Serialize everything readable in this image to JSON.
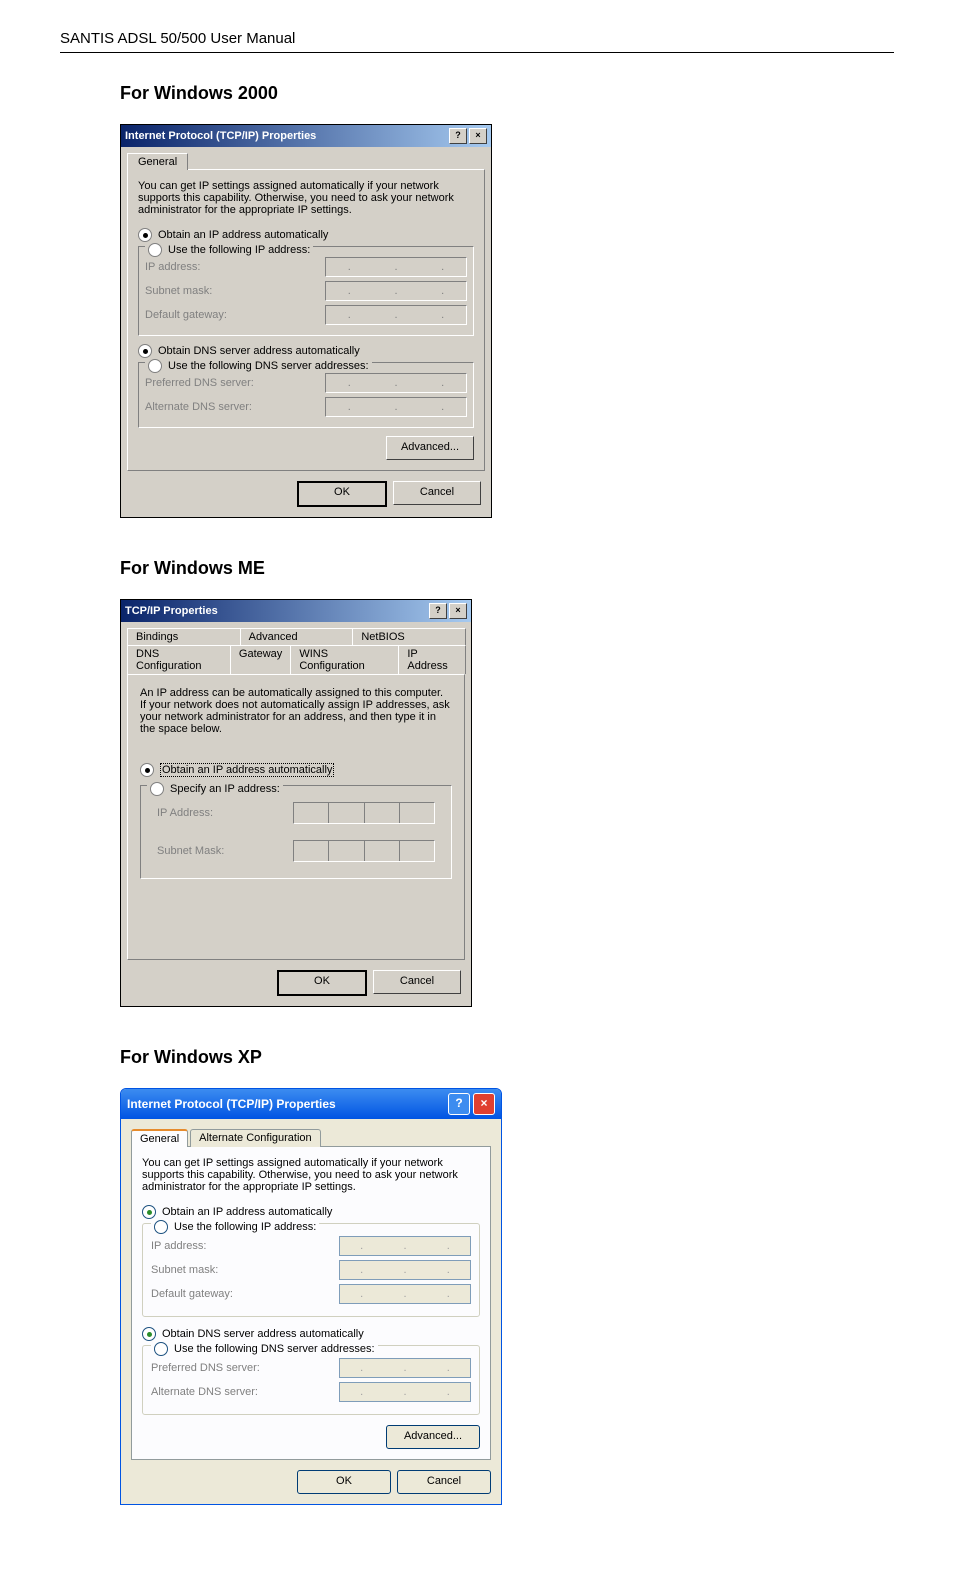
{
  "header": "SANTIS ADSL 50/500 User Manual",
  "sections": {
    "win2000": {
      "heading": "For Windows 2000",
      "dialog": {
        "title": "Internet Protocol (TCP/IP) Properties",
        "tab": "General",
        "description": "You can get IP settings assigned automatically if your network supports this capability. Otherwise, you need to ask your network administrator for the appropriate IP settings.",
        "radio_obtain_ip": "Obtain an IP address automatically",
        "radio_use_ip": "Use the following IP address:",
        "ip_address_label": "IP address:",
        "subnet_label": "Subnet mask:",
        "gateway_label": "Default gateway:",
        "radio_obtain_dns": "Obtain DNS server address automatically",
        "radio_use_dns": "Use the following DNS server addresses:",
        "pref_dns_label": "Preferred DNS server:",
        "alt_dns_label": "Alternate DNS server:",
        "advanced_btn": "Advanced...",
        "ok_btn": "OK",
        "cancel_btn": "Cancel"
      }
    },
    "winme": {
      "heading": "For Windows ME",
      "dialog": {
        "title": "TCP/IP Properties",
        "tabs": {
          "bindings": "Bindings",
          "advanced": "Advanced",
          "netbios": "NetBIOS",
          "dns": "DNS Configuration",
          "gateway": "Gateway",
          "wins": "WINS Configuration",
          "ip": "IP Address"
        },
        "description": "An IP address can be automatically assigned to this computer. If your network does not automatically assign IP addresses, ask your network administrator for an address, and then type it in the space below.",
        "radio_obtain": "Obtain an IP address automatically",
        "radio_specify": "Specify an IP address:",
        "ip_label": "IP Address:",
        "subnet_label": "Subnet Mask:",
        "ok_btn": "OK",
        "cancel_btn": "Cancel"
      }
    },
    "winxp": {
      "heading": "For Windows XP",
      "dialog": {
        "title": "Internet Protocol (TCP/IP) Properties",
        "tab_general": "General",
        "tab_alt": "Alternate Configuration",
        "description": "You can get IP settings assigned automatically if your network supports this capability. Otherwise, you need to ask your network administrator for the appropriate IP settings.",
        "radio_obtain_ip": "Obtain an IP address automatically",
        "radio_use_ip": "Use the following IP address:",
        "ip_address_label": "IP address:",
        "subnet_label": "Subnet mask:",
        "gateway_label": "Default gateway:",
        "radio_obtain_dns": "Obtain DNS server address automatically",
        "radio_use_dns": "Use the following DNS server addresses:",
        "pref_dns_label": "Preferred DNS server:",
        "alt_dns_label": "Alternate DNS server:",
        "advanced_btn": "Advanced...",
        "ok_btn": "OK",
        "cancel_btn": "Cancel"
      }
    }
  }
}
